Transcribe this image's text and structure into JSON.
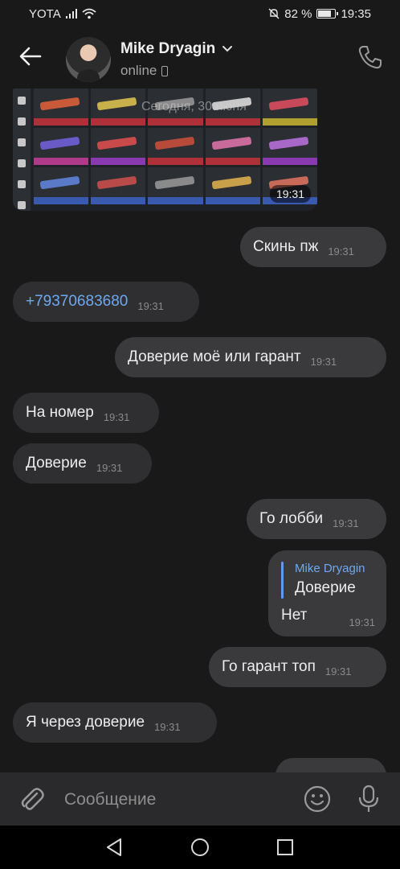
{
  "status_bar": {
    "carrier": "YOTA",
    "battery": "82 %",
    "battery_level": 0.82,
    "time": "19:35"
  },
  "header": {
    "name": "Mike Dryagin",
    "status": "online"
  },
  "photo": {
    "date_stamp": "Сегодня, 30 июня",
    "time": "19:31"
  },
  "messages": [
    {
      "dir": "out",
      "text": "Скинь пж",
      "time": "19:31"
    },
    {
      "dir": "in",
      "text": "+79370683680",
      "time": "19:31",
      "kind": "phone"
    },
    {
      "dir": "out",
      "text": "Доверие моё или гарант",
      "time": "19:31"
    },
    {
      "dir": "in",
      "text": "На номер",
      "time": "19:31"
    },
    {
      "dir": "in",
      "text": "Доверие",
      "time": "19:31"
    },
    {
      "dir": "out",
      "text": "Го лобби",
      "time": "19:31"
    },
    {
      "dir": "out",
      "text": "Го гарант топ",
      "time": "19:31"
    },
    {
      "dir": "in",
      "text": "Я через доверие",
      "time": "19:31"
    }
  ],
  "reply_message": {
    "quoted_name": "Mike Dryagin",
    "quoted_text": "Доверие",
    "text": "Нет",
    "time": "19:31"
  },
  "input": {
    "placeholder": "Сообщение"
  },
  "icons": {
    "back": "arrow-left-icon",
    "call": "phone-icon",
    "attach": "paperclip-icon",
    "emoji": "smiley-icon",
    "mic": "microphone-icon",
    "nav": [
      "back-triangle-icon",
      "home-circle-icon",
      "recents-square-icon"
    ]
  },
  "colors": {
    "background": "#19191a",
    "bubble_out": "#3a3a3c",
    "bubble_in": "#2f2f31",
    "link": "#6fa8ef"
  }
}
